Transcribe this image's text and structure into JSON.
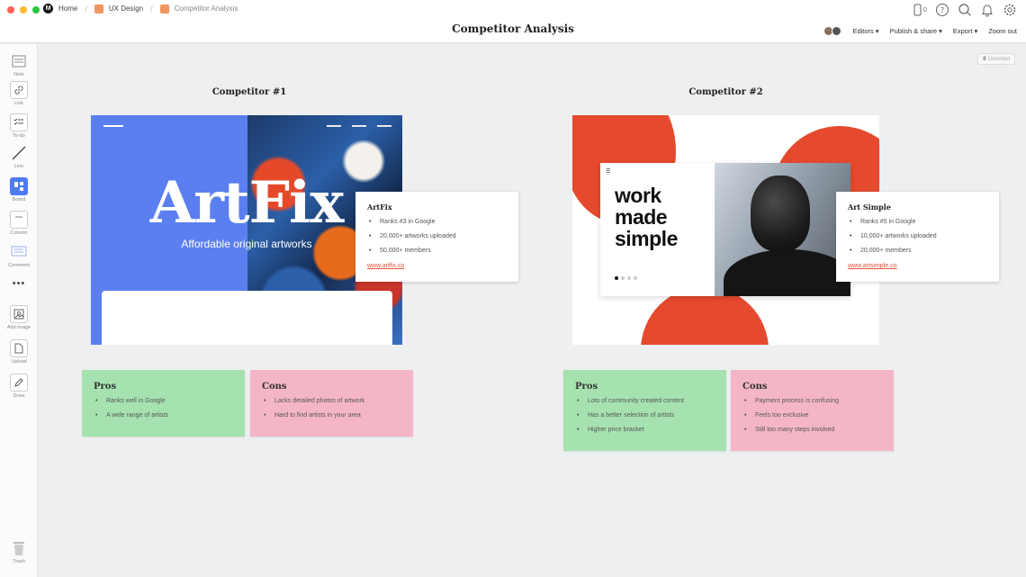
{
  "breadcrumbs": [
    {
      "label": "Home",
      "icon": "milanote-logo-icon"
    },
    {
      "label": "UX Design",
      "icon": "board-icon",
      "color": "#f0955e"
    },
    {
      "label": "Competitor Analysis",
      "icon": "board-icon",
      "color": "#f0955e"
    }
  ],
  "document_title": "Competitor Analysis",
  "top_icons": {
    "mobile_count": "0"
  },
  "top_actions": {
    "editors": "Editors",
    "publish": "Publish & share",
    "export": "Export",
    "zoom": "Zoom out"
  },
  "toolbar": [
    {
      "label": "Note",
      "icon": "note-icon"
    },
    {
      "label": "Link",
      "icon": "link-icon"
    },
    {
      "label": "To-do",
      "icon": "todo-icon"
    },
    {
      "label": "Line",
      "icon": "line-icon"
    },
    {
      "label": "Board",
      "icon": "board-icon"
    },
    {
      "label": "Column",
      "icon": "column-icon"
    },
    {
      "label": "Comment",
      "icon": "comment-icon"
    },
    {
      "label": "",
      "icon": "more-icon"
    },
    {
      "label": "Add image",
      "icon": "image-icon"
    },
    {
      "label": "Upload",
      "icon": "upload-icon"
    },
    {
      "label": "Draw",
      "icon": "pencil-icon"
    },
    {
      "label": "Trash",
      "icon": "trash-icon"
    }
  ],
  "sort": {
    "count": "0",
    "label": "Unsorted"
  },
  "competitors": [
    {
      "heading": "Competitor #1",
      "image": {
        "title": "ArtFix",
        "subtitle": "Affordable original artworks"
      },
      "card": {
        "title": "ArtFix",
        "bullets": [
          "Ranks #3 in Google",
          "20,000+ artworks uploaded",
          "50,000+ members"
        ],
        "link": "www.artfix.co"
      },
      "pros": {
        "title": "Pros",
        "items": [
          "Ranks well in Google",
          "A wide range of artists"
        ]
      },
      "cons": {
        "title": "Cons",
        "items": [
          "Lacks detailed photos of artwork",
          "Hard to find artists in your area"
        ]
      }
    },
    {
      "heading": "Competitor #2",
      "image": {
        "slogan_lines": [
          "work",
          "made",
          "simple"
        ]
      },
      "card": {
        "title": "Art Simple",
        "bullets": [
          "Ranks #5 in Google",
          "10,000+ artworks uploaded",
          "20,000+ members"
        ],
        "link": "www.artsimple.co"
      },
      "pros": {
        "title": "Pros",
        "items": [
          "Lots of community created content",
          "Has a better selection of artists",
          "Higher price bracket"
        ]
      },
      "cons": {
        "title": "Cons",
        "items": [
          "Payment process is confusing",
          "Feels too exclusive",
          "Still too many steps involved"
        ]
      }
    }
  ],
  "colors": {
    "accent": "#4d7bf3",
    "pros": "#a6e2b0",
    "cons": "#f4b6c7",
    "link": "#e5533c",
    "red": "#e54a2e"
  }
}
